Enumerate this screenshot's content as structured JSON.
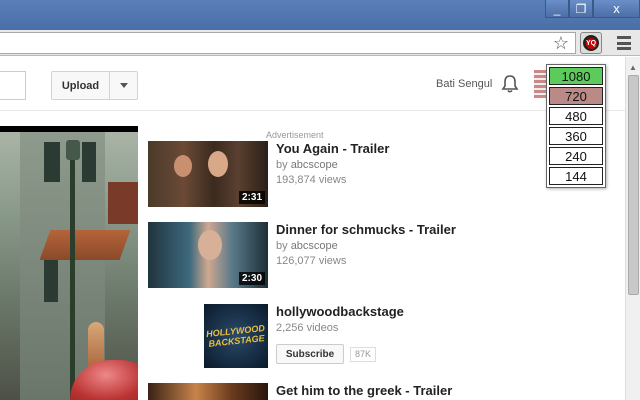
{
  "window": {
    "min_glyph": "_",
    "restore_glyph": "❐",
    "close_glyph": "x"
  },
  "toolbar": {
    "star_glyph": "☆",
    "extension_badge": "YQ"
  },
  "masthead": {
    "upload_label": "Upload",
    "username": "Bati Sengul"
  },
  "quality_menu": {
    "options": [
      {
        "label": "1080",
        "color": "#5ccb5c"
      },
      {
        "label": "720",
        "color": "#b98a86"
      },
      {
        "label": "480",
        "color": "#ffffff"
      },
      {
        "label": "360",
        "color": "#ffffff"
      },
      {
        "label": "240",
        "color": "#ffffff"
      },
      {
        "label": "144",
        "color": "#ffffff"
      }
    ]
  },
  "sidebar": {
    "ad_label": "Advertisement",
    "videos": [
      {
        "title": "You Again - Trailer",
        "by_prefix": "by",
        "channel": "abcscope",
        "views": "193,874 views",
        "duration": "2:31"
      },
      {
        "title": "Dinner for schmucks - Trailer",
        "by_prefix": "by",
        "channel": "abcscope",
        "views": "126,077 views",
        "duration": "2:30"
      },
      {
        "title": "Get him to the greek - Trailer"
      }
    ],
    "channel": {
      "name": "hollywoodbackstage",
      "video_count": "2,256 videos",
      "subscribe_label": "Subscribe",
      "subscriber_count": "87K",
      "logo_text": "HOLLYWOOD BACKSTAGE"
    }
  }
}
